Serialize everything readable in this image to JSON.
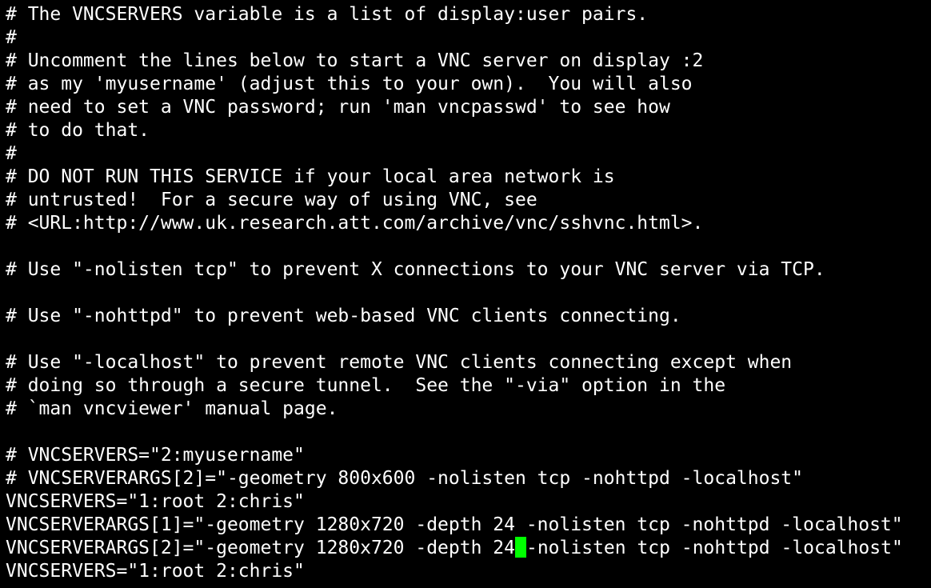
{
  "terminal": {
    "colors": {
      "background": "#000000",
      "foreground": "#ffffff",
      "cursor": "#00ff00"
    },
    "lines": [
      "# The VNCSERVERS variable is a list of display:user pairs.",
      "#",
      "# Uncomment the lines below to start a VNC server on display :2",
      "# as my 'myusername' (adjust this to your own).  You will also",
      "# need to set a VNC password; run 'man vncpasswd' to see how",
      "# to do that.",
      "#",
      "# DO NOT RUN THIS SERVICE if your local area network is",
      "# untrusted!  For a secure way of using VNC, see",
      "# <URL:http://www.uk.research.att.com/archive/vnc/sshvnc.html>.",
      "",
      "# Use \"-nolisten tcp\" to prevent X connections to your VNC server via TCP.",
      "",
      "# Use \"-nohttpd\" to prevent web-based VNC clients connecting.",
      "",
      "# Use \"-localhost\" to prevent remote VNC clients connecting except when",
      "# doing so through a secure tunnel.  See the \"-via\" option in the",
      "# `man vncviewer' manual page.",
      "",
      "# VNCSERVERS=\"2:myusername\"",
      "# VNCSERVERARGS[2]=\"-geometry 800x600 -nolisten tcp -nohttpd -localhost\"",
      "VNCSERVERS=\"1:root 2:chris\"",
      "VNCSERVERARGS[1]=\"-geometry 1280x720 -depth 24 -nolisten tcp -nohttpd -localhost\""
    ],
    "cursor_line": {
      "before": "VNCSERVERARGS[2]=\"-geometry 1280x720 -depth 24",
      "after": "-nolisten tcp -nohttpd -localhost\""
    },
    "last_line": "VNCSERVERS=\"1:root 2:chris\""
  }
}
